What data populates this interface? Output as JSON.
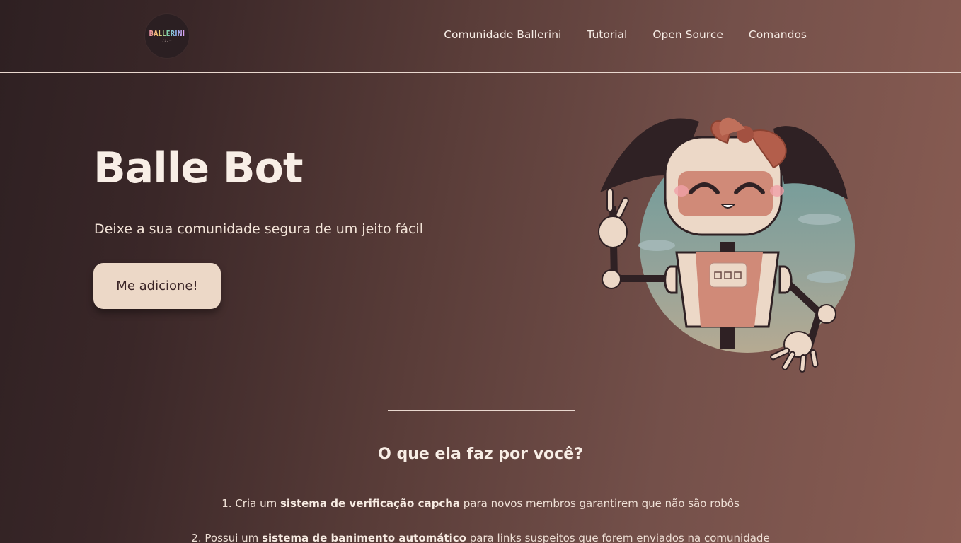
{
  "header": {
    "logo_text": "BALLERINI",
    "logo_sub": "♪♪♪~",
    "nav": [
      {
        "label": "Comunidade Ballerini"
      },
      {
        "label": "Tutorial"
      },
      {
        "label": "Open Source"
      },
      {
        "label": "Comandos"
      }
    ]
  },
  "hero": {
    "title": "Balle Bot",
    "subtitle": "Deixe a sua comunidade segura de um jeito fácil",
    "cta_label": "Me adicione!",
    "illustration": "robot-girl-illustration"
  },
  "features": {
    "title": "O que ela faz por você?",
    "items": [
      {
        "prefix": "1. Cria um ",
        "bold": "sistema de verificação capcha",
        "suffix": " para novos membros garantirem que não são robôs"
      },
      {
        "prefix": "2. Possui um ",
        "bold": "sistema de banimento automático",
        "suffix": " para links suspeitos que forem enviados na comunidade"
      }
    ]
  },
  "colors": {
    "bg_dark": "#2e2022",
    "bg_light": "#8a5d53",
    "button_bg": "#ecd8c7",
    "text_light": "#f8eee6"
  }
}
